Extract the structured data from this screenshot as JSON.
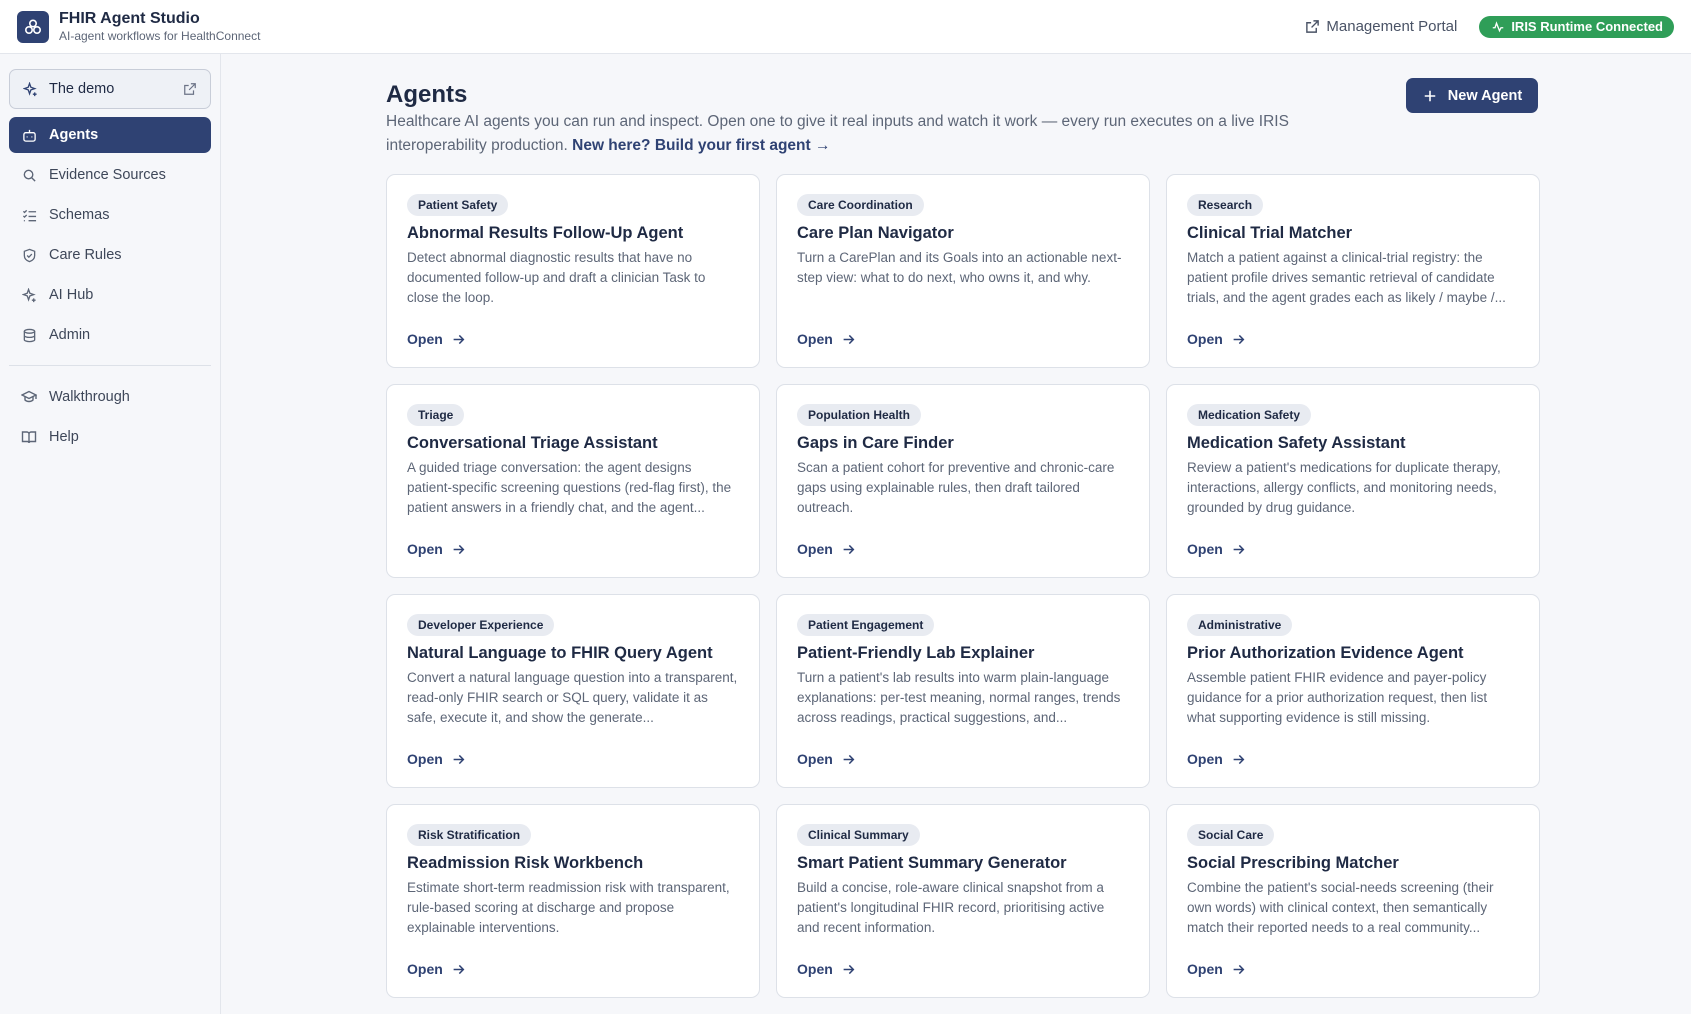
{
  "header": {
    "title": "FHIR Agent Studio",
    "subtitle": "AI-agent workflows for HealthConnect",
    "portal_link": "Management Portal",
    "status": "IRIS Runtime Connected"
  },
  "sidebar": {
    "demo": "The demo",
    "items": [
      {
        "label": "Agents",
        "icon": "bot-icon",
        "active": true
      },
      {
        "label": "Evidence Sources",
        "icon": "search-icon"
      },
      {
        "label": "Schemas",
        "icon": "list-checks-icon"
      },
      {
        "label": "Care Rules",
        "icon": "shield-icon"
      },
      {
        "label": "AI Hub",
        "icon": "sparkles-icon"
      },
      {
        "label": "Admin",
        "icon": "database-icon"
      }
    ],
    "secondary": [
      {
        "label": "Walkthrough",
        "icon": "graduation-cap-icon"
      },
      {
        "label": "Help",
        "icon": "book-open-icon"
      }
    ]
  },
  "main": {
    "title": "Agents",
    "intro": "Healthcare AI agents you can run and inspect. Open one to give it real inputs and watch it work — every run executes on a live IRIS interoperability production.",
    "intro_link": "New here? Build your first agent →",
    "new_agent_label": "New Agent",
    "open_label": "Open",
    "cards": [
      {
        "tag": "Patient Safety",
        "title": "Abnormal Results Follow-Up Agent",
        "desc": "Detect abnormal diagnostic results that have no documented follow-up and draft a clinician Task to close the loop."
      },
      {
        "tag": "Care Coordination",
        "title": "Care Plan Navigator",
        "desc": "Turn a CarePlan and its Goals into an actionable next-step view: what to do next, who owns it, and why."
      },
      {
        "tag": "Research",
        "title": "Clinical Trial Matcher",
        "desc": "Match a patient against a clinical-trial registry: the patient profile drives semantic retrieval of candidate trials, and the agent grades each as likely / maybe /..."
      },
      {
        "tag": "Triage",
        "title": "Conversational Triage Assistant",
        "desc": "A guided triage conversation: the agent designs patient-specific screening questions (red-flag first), the patient answers in a friendly chat, and the agent..."
      },
      {
        "tag": "Population Health",
        "title": "Gaps in Care Finder",
        "desc": "Scan a patient cohort for preventive and chronic-care gaps using explainable rules, then draft tailored outreach."
      },
      {
        "tag": "Medication Safety",
        "title": "Medication Safety Assistant",
        "desc": "Review a patient's medications for duplicate therapy, interactions, allergy conflicts, and monitoring needs, grounded by drug guidance."
      },
      {
        "tag": "Developer Experience",
        "title": "Natural Language to FHIR Query Agent",
        "desc": "Convert a natural language question into a transparent, read-only FHIR search or SQL query, validate it as safe, execute it, and show the generate..."
      },
      {
        "tag": "Patient Engagement",
        "title": "Patient-Friendly Lab Explainer",
        "desc": "Turn a patient's lab results into warm plain-language explanations: per-test meaning, normal ranges, trends across readings, practical suggestions, and..."
      },
      {
        "tag": "Administrative",
        "title": "Prior Authorization Evidence Agent",
        "desc": "Assemble patient FHIR evidence and payer-policy guidance for a prior authorization request, then list what supporting evidence is still missing."
      },
      {
        "tag": "Risk Stratification",
        "title": "Readmission Risk Workbench",
        "desc": "Estimate short-term readmission risk with transparent, rule-based scoring at discharge and propose explainable interventions."
      },
      {
        "tag": "Clinical Summary",
        "title": "Smart Patient Summary Generator",
        "desc": "Build a concise, role-aware clinical snapshot from a patient's longitudinal FHIR record, prioritising active and recent information."
      },
      {
        "tag": "Social Care",
        "title": "Social Prescribing Matcher",
        "desc": "Combine the patient's social-needs screening (their own words) with clinical context, then semantically match their reported needs to a real community..."
      }
    ]
  },
  "colors": {
    "brand": "#2f4273",
    "status_green": "#2f9e58",
    "background": "#f6f7fa"
  }
}
